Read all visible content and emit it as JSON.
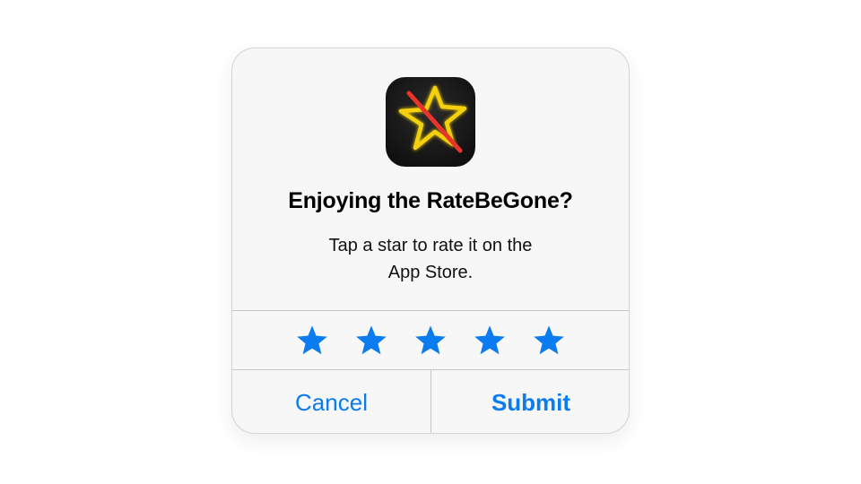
{
  "dialog": {
    "app_icon": "starbe-gone-app-icon",
    "title": "Enjoying the RateBeGone?",
    "message_line1": "Tap a star to rate it on the",
    "message_line2": "App Store.",
    "star_rating": {
      "max": 5,
      "selected": 0,
      "icon": "star-icon"
    },
    "cancel_label": "Cancel",
    "submit_label": "Submit"
  },
  "colors": {
    "accent": "#0a7cf0",
    "dialog_background": "#f7f7f7",
    "divider": "#c6c6c6",
    "icon_star": "#f5d10a",
    "icon_slash": "#e8342a",
    "icon_background": "#141414"
  }
}
